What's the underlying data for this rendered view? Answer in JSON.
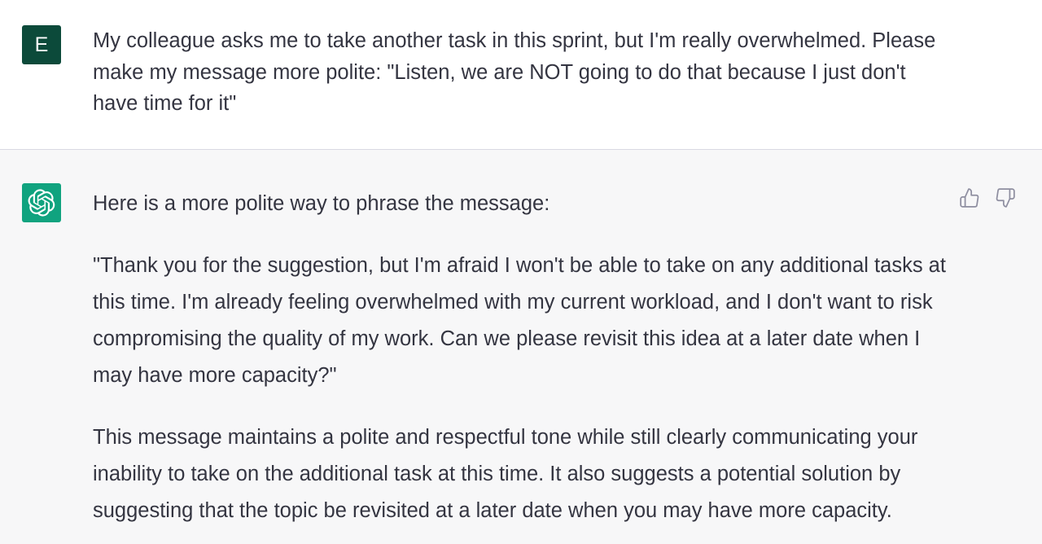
{
  "user": {
    "avatar_letter": "E",
    "avatar_color": "#0c4a3a",
    "message": "My colleague asks me to take another task in this sprint, but I'm really overwhelmed. Please make my message more polite: \"Listen, we are NOT going to do that because I just don't have time for it\""
  },
  "assistant": {
    "avatar_icon": "openai-logo-icon",
    "avatar_color": "#10a37f",
    "paragraphs": [
      "Here is a more polite way to phrase the message:",
      "\"Thank you for the suggestion, but I'm afraid I won't be able to take on any additional tasks at this time. I'm already feeling overwhelmed with my current workload, and I don't want to risk compromising the quality of my work. Can we please revisit this idea at a later date when I may have more capacity?\"",
      "This message maintains a polite and respectful tone while still clearly communicating your inability to take on the additional task at this time. It also suggests a potential solution by suggesting that the topic be revisited at a later date when you may have more capacity."
    ],
    "feedback": {
      "thumbs_up_icon": "thumbs-up-icon",
      "thumbs_down_icon": "thumbs-down-icon"
    }
  }
}
